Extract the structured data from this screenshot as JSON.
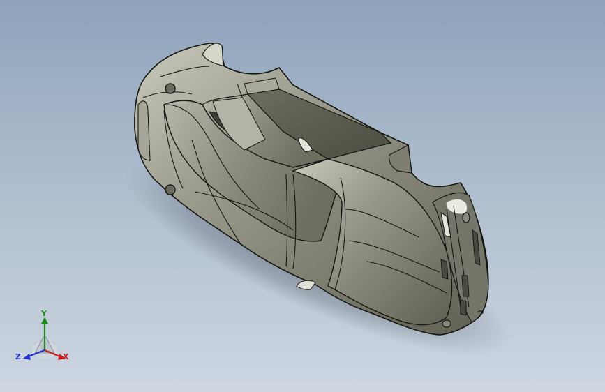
{
  "viewport": {
    "background_top": "#8fa3bb",
    "background_bottom": "#cdd6e1"
  },
  "model": {
    "body_color": "#8e8f80",
    "highlight_color": "#d8d9ce",
    "edge_color": "#141510"
  },
  "triad": {
    "x_label": "X",
    "y_label": "Y",
    "z_label": "Z",
    "x_color": "#c81e1e",
    "y_color": "#1c8a1c",
    "z_color": "#2032c8",
    "icon": "coordinate-triad-icon"
  }
}
